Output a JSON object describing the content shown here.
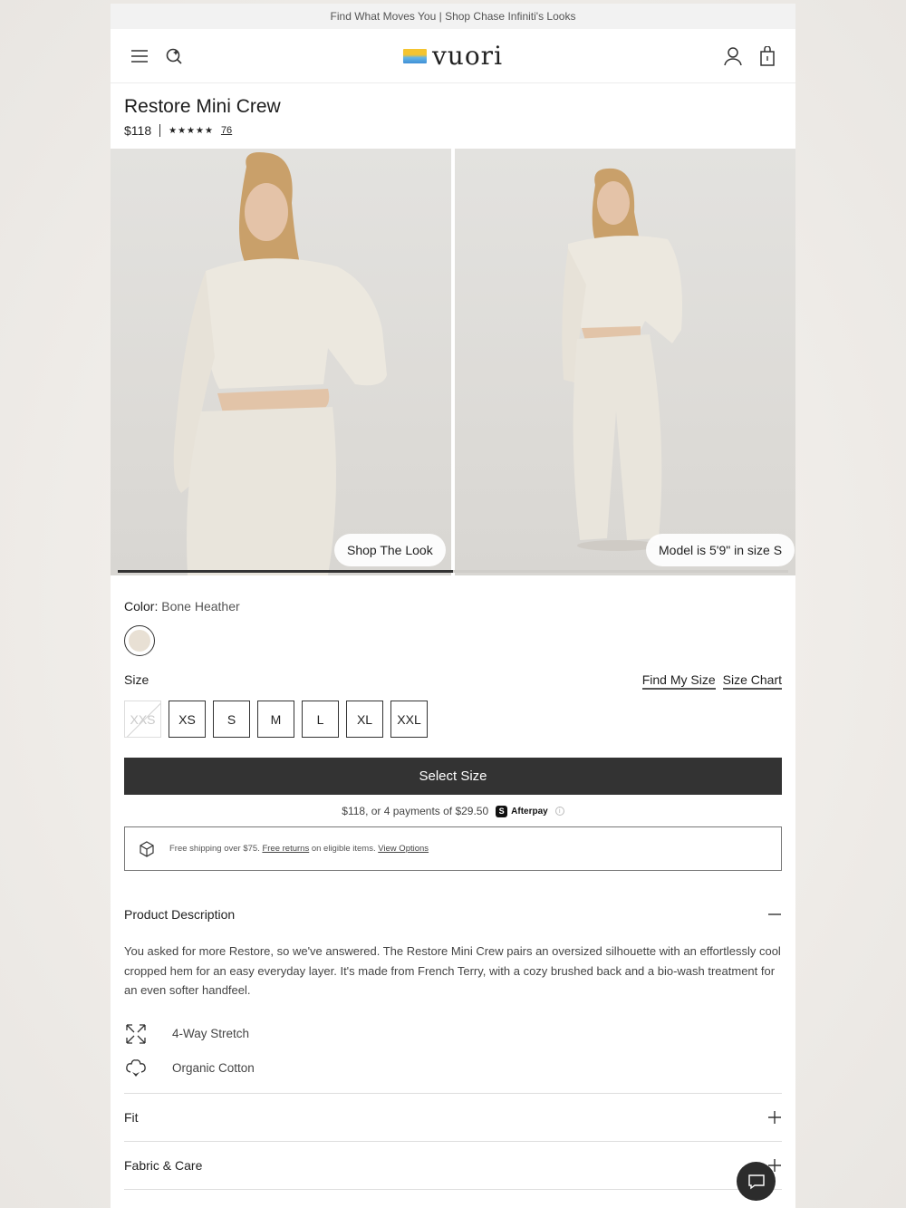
{
  "promo": {
    "text": "Find What Moves You | Shop Chase Infiniti's Looks"
  },
  "header": {
    "icons": [
      "menu-icon",
      "search-icon",
      "account-icon",
      "bag-icon"
    ],
    "logo_text": "vuori"
  },
  "product": {
    "title": "Restore Mini Crew",
    "price": "$118",
    "rating_stars": "★★★★★",
    "rating": 4.5,
    "review_count": "76"
  },
  "gallery": {
    "images": [
      {
        "pill": "Shop The Look",
        "icon": "model-photo-front"
      },
      {
        "pill": "Model is 5'9\" in size S",
        "icon": "model-photo-full"
      }
    ],
    "progress": 0.5
  },
  "color": {
    "label": "Color:",
    "value": "Bone Heather",
    "swatch": "#e8e0d4"
  },
  "size": {
    "label": "Size",
    "find_my_size": "Find My Size",
    "size_chart": "Size Chart",
    "options": [
      {
        "label": "XXS",
        "available": false
      },
      {
        "label": "XS",
        "available": true
      },
      {
        "label": "S",
        "available": true
      },
      {
        "label": "M",
        "available": true
      },
      {
        "label": "L",
        "available": true
      },
      {
        "label": "XL",
        "available": true
      },
      {
        "label": "XXL",
        "available": true
      }
    ]
  },
  "cta": {
    "select_size": "Select Size"
  },
  "afterpay": {
    "text": "$118, or 4 payments of $29.50",
    "badge": "S",
    "brand": "Afterpay",
    "info": "i"
  },
  "shipping": {
    "text1": "Free shipping over $75.",
    "link1": "Free returns",
    "text2": "on eligible items.",
    "link2": "View Options"
  },
  "description": {
    "heading": "Product Description",
    "body": "You asked for more Restore, so we've answered. The Restore Mini Crew pairs an oversized silhouette with an effortlessly cool cropped hem for an easy everyday layer. It's made from French Terry, with a cozy brushed back and a bio-wash treatment for an even softer handfeel.",
    "features": [
      {
        "label": "4-Way Stretch",
        "icon": "stretch-arrows-icon"
      },
      {
        "label": "Organic Cotton",
        "icon": "cotton-icon"
      }
    ]
  },
  "accordions": [
    {
      "label": "Fit"
    },
    {
      "label": "Fabric & Care"
    }
  ],
  "colors": {
    "cta_bg": "#333333",
    "text": "#222222",
    "promo_bg": "#f2f2f2"
  }
}
